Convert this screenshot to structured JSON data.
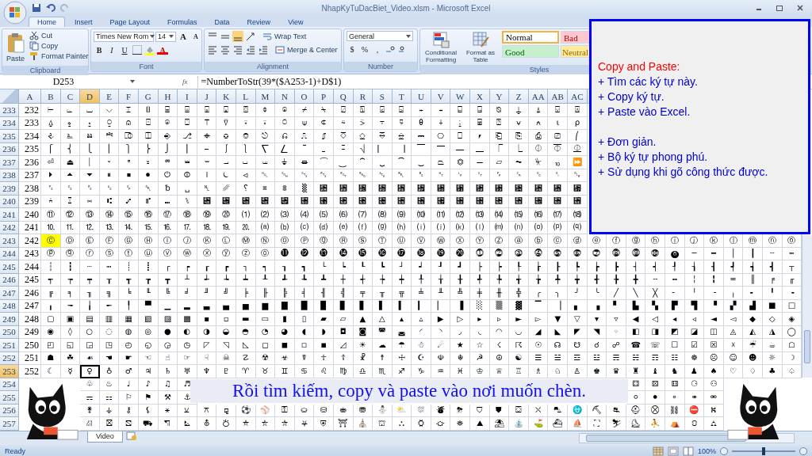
{
  "window": {
    "title": "NhapKyTuDacBiet_Video.xlsm - Microsoft Excel"
  },
  "ribbon_tabs": [
    {
      "label": "Home",
      "selected": true
    },
    {
      "label": "Insert",
      "selected": false
    },
    {
      "label": "Page Layout",
      "selected": false
    },
    {
      "label": "Formulas",
      "selected": false
    },
    {
      "label": "Data",
      "selected": false
    },
    {
      "label": "Review",
      "selected": false
    },
    {
      "label": "View",
      "selected": false
    }
  ],
  "ribbon": {
    "clipboard": {
      "label": "Clipboard",
      "paste": "Paste",
      "cut": "Cut",
      "copy": "Copy",
      "format_painter": "Format Painter"
    },
    "font": {
      "label": "Font",
      "family": "Times New Rom",
      "size": "14",
      "grow": "A",
      "shrink": "A",
      "bold": "B",
      "italic": "I",
      "underline": "U",
      "font_color": "A"
    },
    "alignment": {
      "label": "Alignment",
      "wrap_text": "Wrap Text",
      "merge_center": "Merge & Center"
    },
    "number": {
      "label": "Number",
      "format": "General",
      "currency": "$",
      "percent": "%",
      "comma": ","
    },
    "styles": {
      "label": "Styles",
      "conditional_formatting": "Conditional Formatting",
      "format_as_table": "Format as Table",
      "cell_styles": [
        {
          "label": "Normal",
          "color": "#ffffff"
        },
        {
          "label": "Bad",
          "color": "#ffc7ce"
        },
        {
          "label": "Good",
          "color": "#c6efce"
        },
        {
          "label": "Neutral",
          "color": "#ffeb9c"
        }
      ]
    }
  },
  "formula_bar": {
    "name_box": "D253",
    "fx": "fx",
    "formula": "=NumberToStr(39*($A253-1)+D$1)"
  },
  "grid": {
    "columns": [
      "A",
      "B",
      "C",
      "D",
      "E",
      "F",
      "G",
      "H",
      "I",
      "J",
      "K",
      "L",
      "M",
      "N",
      "O",
      "P",
      "Q",
      "R",
      "S",
      "T",
      "U",
      "V",
      "W",
      "X",
      "Y",
      "Z",
      "AA",
      "AB",
      "AC"
    ],
    "rows": [
      {
        "header": "233",
        "cells": [
          "232",
          "⌲",
          "⌳",
          "⌴",
          "⌵",
          "⌶",
          "⌷",
          "⌸",
          "⌹",
          "⌺",
          "⌻",
          "⌼",
          "⌽",
          "⌾",
          "⌿",
          "⍀",
          "⍁",
          "⍂",
          "⍃",
          "⍄",
          "⍅",
          "⍆",
          "⍇",
          "⍈",
          "⍉",
          "⍊",
          "⍋",
          "⍌",
          "⍍"
        ]
      },
      {
        "header": "234",
        "cells": [
          "233",
          "⍙",
          "⍚",
          "⍛",
          "⍜",
          "⍝",
          "⍞",
          "⍟",
          "⍠",
          "⍡",
          "⍢",
          "⍣",
          "⍤",
          "⍥",
          "⍦",
          "⍧",
          "⍨",
          "⍩",
          "⍪",
          "⍫",
          "⍬",
          "⍭",
          "⍮",
          "⍯",
          "⍰",
          "⍱",
          "⍲",
          "⍳",
          "⍴"
        ]
      },
      {
        "header": "235",
        "cells": [
          "234",
          "⎀",
          "⎁",
          "⎂",
          "⎃",
          "⎄",
          "⎅",
          "⎆",
          "⎇",
          "⎈",
          "⎉",
          "⎊",
          "⎋",
          "⎌",
          "⎍",
          "⎎",
          "⎏",
          "⎐",
          "⎑",
          "⎒",
          "⎓",
          "⎔",
          "⎕",
          "⎖",
          "⎗",
          "⎘",
          "⎙",
          "⎚",
          "⎛"
        ]
      },
      {
        "header": "236",
        "cells": [
          "235",
          "⎧",
          "⎨",
          "⎩",
          "⎪",
          "⎫",
          "⎬",
          "⎭",
          "⎮",
          "⎯",
          "⎰",
          "⎱",
          "⎲",
          "⎳",
          "⎴",
          "⎵",
          "⎶",
          "⎷",
          "⎸",
          "⎹",
          "⎺",
          "⎻",
          "⎼",
          "⎽",
          "⎾",
          "⎿",
          "⏀",
          "⏁",
          "⏂"
        ]
      },
      {
        "header": "237",
        "cells": [
          "236",
          "⏎",
          "⏏",
          "⏐",
          "⏑",
          "⏒",
          "⏓",
          "⏔",
          "⏕",
          "⏖",
          "⏗",
          "⏘",
          "⏙",
          "⏚",
          "⏛",
          "⏜",
          "⏝",
          "⏞",
          "⏟",
          "⏠",
          "⏡",
          "⏢",
          "⏣",
          "⏤",
          "⏥",
          "⏦",
          "⏧",
          "⏨",
          "⏩"
        ]
      },
      {
        "header": "238",
        "cells": [
          "237",
          "⏵",
          "⏶",
          "⏷",
          "⏸",
          "⏹",
          "⏺",
          "⏻",
          "⏼",
          "⏽",
          "⏾",
          "⏿",
          "␀",
          "␁",
          "␂",
          "␃",
          "␄",
          "␅",
          "␆",
          "␇",
          "␈",
          "␉",
          "␊",
          "␋",
          "␌",
          "␍",
          "␎",
          "␏",
          "␐"
        ]
      },
      {
        "header": "239",
        "cells": [
          "238",
          "␜",
          "␝",
          "␞",
          "␟",
          "␠",
          "␡",
          "␢",
          "␣",
          "␤",
          "␥",
          "␦",
          "␧",
          "␨",
          "␩",
          "␪",
          "␫",
          "␬",
          "␭",
          "␮",
          "␯",
          "␰",
          "␱",
          "␲",
          "␳",
          "␴",
          "␵",
          "␶",
          "␷"
        ]
      },
      {
        "header": "240",
        "cells": [
          "239",
          "⑃",
          "⑄",
          "⑅",
          "⑆",
          "⑇",
          "⑈",
          "⑉",
          "⑊",
          "⑋",
          "⑌",
          "⑍",
          "⑎",
          "⑏",
          "⑐",
          "⑑",
          "⑒",
          "⑓",
          "⑔",
          "⑕",
          "⑖",
          "⑗",
          "⑘",
          "⑙",
          "⑚",
          "⑛",
          "⑜",
          "⑝",
          "⑞"
        ]
      },
      {
        "header": "241",
        "cells": [
          "240",
          "⑪",
          "⑫",
          "⑬",
          "⑭",
          "⑮",
          "⑯",
          "⑰",
          "⑱",
          "⑲",
          "⑳",
          "⑴",
          "⑵",
          "⑶",
          "⑷",
          "⑸",
          "⑹",
          "⑺",
          "⑻",
          "⑼",
          "⑽",
          "⑾",
          "⑿",
          "⒀",
          "⒁",
          "⒂",
          "⒃",
          "⒄",
          "⒅"
        ]
      },
      {
        "header": "242",
        "cells": [
          "241",
          "⒑",
          "⒒",
          "⒓",
          "⒔",
          "⒕",
          "⒖",
          "⒗",
          "⒘",
          "⒙",
          "⒚",
          "⒛",
          "⒜",
          "⒝",
          "⒞",
          "⒟",
          "⒠",
          "⒡",
          "⒢",
          "⒣",
          "⒤",
          "⒥",
          "⒦",
          "⒧",
          "⒨",
          "⒩",
          "⒪",
          "⒫",
          "⒬"
        ]
      },
      {
        "header": "243",
        "cells": [
          "242",
          {
            "text": "Ⓒ",
            "color": "#ffff00"
          },
          "Ⓓ",
          "Ⓔ",
          "Ⓕ",
          "Ⓖ",
          "Ⓗ",
          "Ⓘ",
          "Ⓙ",
          "Ⓚ",
          "Ⓛ",
          "Ⓜ",
          "Ⓝ",
          "Ⓞ",
          "Ⓟ",
          "Ⓠ",
          "Ⓡ",
          "Ⓢ",
          "Ⓣ",
          "Ⓤ",
          "Ⓥ",
          "Ⓦ",
          "Ⓧ",
          "Ⓨ",
          "Ⓩ",
          "ⓐ",
          "ⓑ",
          "ⓒ",
          "ⓓ",
          "ⓔ",
          "ⓕ",
          "ⓖ",
          "ⓗ",
          "ⓘ",
          "ⓙ",
          "ⓚ",
          "ⓛ",
          "ⓜ",
          "ⓝ",
          "ⓞ"
        ]
      },
      {
        "header": "244",
        "cells": [
          "243",
          "ⓟ",
          "ⓠ",
          "ⓡ",
          "ⓢ",
          "ⓣ",
          "ⓤ",
          "ⓥ",
          "ⓦ",
          "ⓧ",
          "ⓨ",
          "ⓩ",
          "⓪",
          "⓫",
          "⓬",
          "⓭",
          "⓮",
          "⓯",
          "⓰",
          "⓱",
          "⓲",
          "⓳",
          "⓴",
          "⓵",
          "⓶",
          "⓷",
          "⓸",
          "⓹",
          "⓺",
          "⓻",
          "⓼",
          "⓽",
          "⓾",
          "⓿",
          "─",
          "━",
          "│",
          "┃",
          "┄",
          "┅"
        ]
      },
      {
        "header": "245",
        "cells": [
          "244",
          "┆",
          "┇",
          "┈",
          "┉",
          "┊",
          "┋",
          "┌",
          "┍",
          "┎",
          "┏",
          "┐",
          "┑",
          "┒",
          "┓",
          "└",
          "┕",
          "┖",
          "┗",
          "┘",
          "┙",
          "┚",
          "┛",
          "├",
          "┝",
          "┞",
          "┟",
          "┠",
          "┡",
          "┢",
          "┣",
          "┤",
          "┥",
          "┦",
          "┧",
          "┨",
          "┩",
          "┪",
          "┫",
          "┬"
        ]
      },
      {
        "header": "246",
        "cells": [
          "245",
          "┭",
          "┮",
          "┯",
          "┰",
          "┱",
          "┲",
          "┳",
          "┴",
          "┵",
          "┶",
          "┷",
          "┸",
          "┹",
          "┺",
          "┻",
          "┼",
          "┽",
          "┾",
          "┿",
          "╀",
          "╁",
          "╂",
          "╃",
          "╄",
          "╅",
          "╆",
          "╇",
          "╈",
          "╉",
          "╊",
          "╋",
          "╌",
          "╍",
          "╎",
          "╏",
          "═",
          "║",
          "╒",
          "╓"
        ]
      },
      {
        "header": "247",
        "cells": [
          "246",
          "╔",
          "╕",
          "╖",
          "╗",
          "╘",
          "╙",
          "╚",
          "╛",
          "╜",
          "╝",
          "╞",
          "╟",
          "╠",
          "╡",
          "╢",
          "╣",
          "╤",
          "╥",
          "╦",
          "╧",
          "╨",
          "╩",
          "╪",
          "╫",
          "╬",
          "╭",
          "╮",
          "╯",
          "╰",
          "╱",
          "╲",
          "╳",
          "╴",
          "╵",
          "╶",
          "╷",
          "╸",
          "╹",
          "╺"
        ]
      },
      {
        "header": "248",
        "cells": [
          "247",
          "╻",
          "╼",
          "╽",
          "╾",
          "╿",
          "▀",
          "▁",
          "▂",
          "▃",
          "▄",
          "▅",
          "▆",
          "▇",
          "█",
          "▉",
          "▊",
          "▋",
          "▌",
          "▍",
          "▎",
          "▏",
          "▐",
          "░",
          "▒",
          "▓",
          "▔",
          "▕",
          "▖",
          "▗",
          "▘",
          "▙",
          "▚",
          "▛",
          "▜",
          "▝",
          "▞",
          "▟",
          "■",
          "□"
        ]
      },
      {
        "header": "249",
        "cells": [
          "248",
          "▢",
          "▣",
          "▤",
          "▥",
          "▦",
          "▧",
          "▨",
          "▩",
          "▪",
          "▫",
          "▬",
          "▭",
          "▮",
          "▯",
          "▰",
          "▱",
          "▲",
          "△",
          "▴",
          "▵",
          "▶",
          "▷",
          "▸",
          "▹",
          "►",
          "▻",
          "▼",
          "▽",
          "▾",
          "▿",
          "◀",
          "◁",
          "◂",
          "◃",
          "◄",
          "◅",
          "◆",
          "◇",
          "◈"
        ]
      },
      {
        "header": "250",
        "cells": [
          "249",
          "◉",
          "◊",
          "○",
          "◌",
          "◍",
          "◎",
          "●",
          "◐",
          "◑",
          "◒",
          "◓",
          "◔",
          "◕",
          "◖",
          "◗",
          "◘",
          "◙",
          "◚",
          "◛",
          "◜",
          "◝",
          "◞",
          "◟",
          "◠",
          "◡",
          "◢",
          "◣",
          "◤",
          "◥",
          "◦",
          "◧",
          "◨",
          "◩",
          "◪",
          "◫",
          "◬",
          "◭",
          "◮",
          "◯"
        ]
      },
      {
        "header": "251",
        "cells": [
          "250",
          "◰",
          "◱",
          "◲",
          "◳",
          "◴",
          "◵",
          "◶",
          "◷",
          "◸",
          "◹",
          "◺",
          "◻",
          "◼",
          "◽",
          "◾",
          "◿",
          "☀",
          "☁",
          "☂",
          "☃",
          "☄",
          "★",
          "☆",
          "☇",
          "☈",
          "☉",
          "☊",
          "☋",
          "☌",
          "☍",
          "☎",
          "☏",
          "☐",
          "☑",
          "☒",
          "☓",
          "☔",
          "☕",
          "☖"
        ]
      },
      {
        "header": "252",
        "cells": [
          "251",
          "☗",
          "☘",
          "☙",
          "☚",
          "☛",
          "☜",
          "☝",
          "☞",
          "☟",
          "☠",
          "☡",
          "☢",
          "☣",
          "☤",
          "☥",
          "☦",
          "☧",
          "☨",
          "☩",
          "☪",
          "☫",
          "☬",
          "☭",
          "☮",
          "☯",
          "☰",
          "☱",
          "☲",
          "☳",
          "☴",
          "☵",
          "☶",
          "☷",
          "☸",
          "☹",
          "☺",
          "☻",
          "☼",
          "☽"
        ]
      },
      {
        "header": "253",
        "cells": [
          "252",
          "☾",
          "☿",
          {
            "text": "♀",
            "selected": true
          },
          "♁",
          "♂",
          "♃",
          "♄",
          "♅",
          "♆",
          "♇",
          "♈",
          "♉",
          "♊",
          "♋",
          "♌",
          "♍",
          "♎",
          "♏",
          "♐",
          "♑",
          "♒",
          "♓",
          "♔",
          "♕",
          "♖",
          "♗",
          "♘",
          "♙",
          "♚",
          "♛",
          "♜",
          "♝",
          "♞",
          "♟",
          "♠",
          "♡",
          "♢",
          "♣",
          "♤"
        ]
      },
      {
        "header": "254",
        "cells": [
          null,
          null,
          null,
          "♧",
          "♨",
          "♩",
          "♪",
          "♫",
          "♬",
          null,
          null,
          null,
          null,
          null,
          null,
          null,
          null,
          null,
          null,
          null,
          null,
          null,
          null,
          null,
          null,
          null,
          null,
          null,
          null,
          null,
          null,
          "⚃",
          "⚄",
          "⚅",
          "⚆",
          "⚇",
          null,
          null,
          null,
          null
        ]
      },
      {
        "header": "255",
        "cells": [
          null,
          null,
          null,
          "⚎",
          "⚏",
          "⚐",
          "⚑",
          "⚒",
          "⚓",
          null,
          null,
          null,
          null,
          null,
          null,
          null,
          null,
          null,
          null,
          null,
          null,
          null,
          null,
          null,
          null,
          null,
          null,
          null,
          null,
          null,
          null,
          "⚪",
          "⚫",
          "⚬",
          "⚭",
          "⚮",
          null,
          null,
          null,
          null
        ]
      },
      {
        "header": "256",
        "cells": [
          null,
          null,
          null,
          "⚵",
          "⚶",
          "⚷",
          "⚸",
          "⚹",
          "⚺",
          "⚻",
          "⚼",
          "⚽",
          "⚾",
          "⚿",
          "⛀",
          "⛁",
          "⛂",
          "⛃",
          "⛄",
          "⛅",
          "⛆",
          "⛇",
          "⛈",
          "⛉",
          "⛊",
          "⛋",
          "⛌",
          "⛍",
          "⛎",
          "⛏",
          "⛐",
          "⛑",
          "⛒",
          "⛓",
          "⛔",
          "⛕",
          null,
          null,
          null,
          null
        ]
      },
      {
        "header": "257",
        "cells": [
          null,
          null,
          null,
          "⛜",
          "⛝",
          "⛞",
          "⛟",
          "⛠",
          "⛡",
          "⛢",
          "⛣",
          "⛤",
          "⛥",
          "⛦",
          "⛧",
          "⛨",
          "⛩",
          "⛪",
          "⛫",
          "⛬",
          "⛭",
          "⛮",
          "⛯",
          "⛰",
          "⛱",
          "⛲",
          "⛳",
          "⛴",
          "⛵",
          "⛶",
          "⛷",
          "⛸",
          "⛹",
          "⛺",
          "⛻",
          "⛼",
          null,
          null,
          null,
          null
        ]
      }
    ]
  },
  "sheet_tabs": [
    {
      "label": "Video",
      "selected": true
    }
  ],
  "status_bar": {
    "status": "Ready",
    "zoom": "100%",
    "zoom_slider": {
      "level": 0.5
    }
  },
  "note": {
    "title": "Copy and Paste:",
    "groups": [
      [
        "+ Tìm các ký tự này.",
        "+ Copy ký tự.",
        "+ Paste vào Excel."
      ],
      [
        "+ Đơn giản.",
        "+ Bộ ký tự phong phú.",
        "+ Sử dụng khi gõ công thức được."
      ]
    ]
  },
  "caption": "Rồi tìm kiếm, copy và paste vào nơi muốn chèn."
}
